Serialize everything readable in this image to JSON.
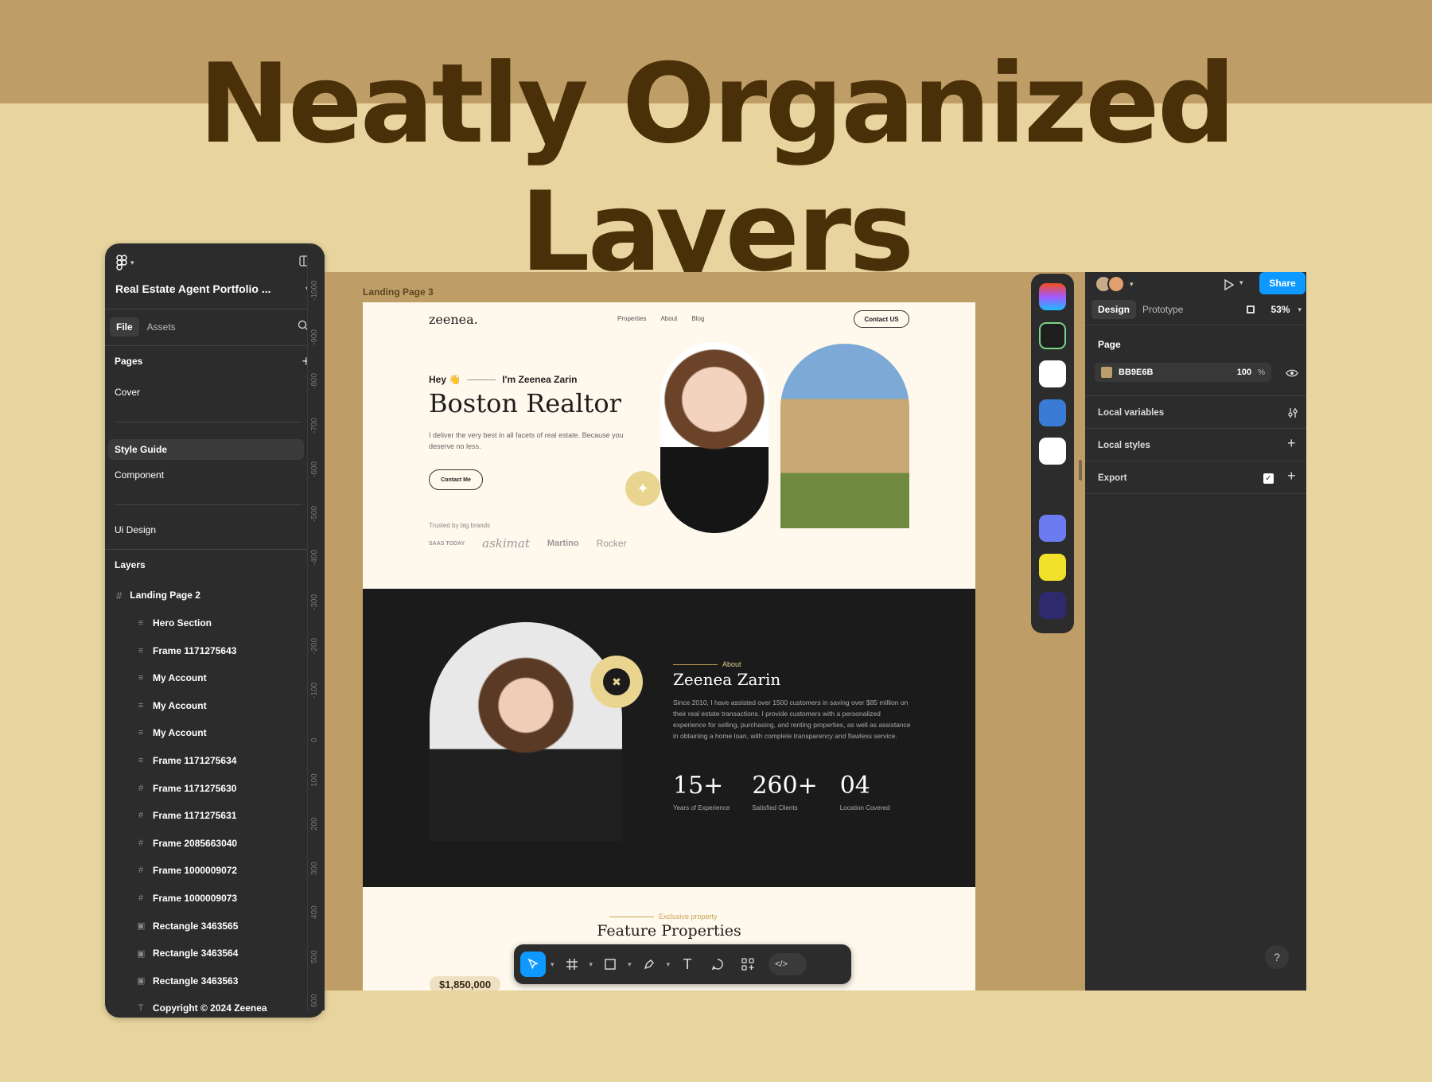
{
  "headline": "Neatly Organized Layers",
  "left_panel": {
    "project_title": "Real Estate Agent Portfolio ...",
    "tab_file": "File",
    "tab_assets": "Assets",
    "pages_header": "Pages",
    "pages": [
      "Cover",
      "Style Guide",
      "Component",
      "Ui Design"
    ],
    "selected_page": "Style Guide",
    "layers_header": "Layers",
    "layer_root": "Landing Page 2",
    "layers": [
      {
        "name": "Hero Section",
        "icon": "auto-layout-icon"
      },
      {
        "name": "Frame 1171275643",
        "icon": "auto-layout-icon"
      },
      {
        "name": "My Account",
        "icon": "auto-layout-icon"
      },
      {
        "name": "My Account",
        "icon": "auto-layout-icon"
      },
      {
        "name": "My Account",
        "icon": "auto-layout-icon"
      },
      {
        "name": "Frame 1171275634",
        "icon": "auto-layout-icon"
      },
      {
        "name": "Frame 1171275630",
        "icon": "frame-icon"
      },
      {
        "name": "Frame 1171275631",
        "icon": "frame-icon"
      },
      {
        "name": "Frame 2085663040",
        "icon": "frame-icon"
      },
      {
        "name": "Frame 1000009072",
        "icon": "frame-icon"
      },
      {
        "name": "Frame 1000009073",
        "icon": "frame-icon"
      },
      {
        "name": "Rectangle 3463565",
        "icon": "image-icon"
      },
      {
        "name": "Rectangle 3463564",
        "icon": "image-icon"
      },
      {
        "name": "Rectangle 3463563",
        "icon": "image-icon"
      },
      {
        "name": "Copyright © 2024 Zeenea",
        "icon": "text-icon"
      }
    ],
    "ruler_ticks": [
      "-1000",
      "-900",
      "-800",
      "-700",
      "-600",
      "-500",
      "-400",
      "-300",
      "-200",
      "-100",
      "0",
      "100",
      "200",
      "300",
      "400",
      "500",
      "600"
    ]
  },
  "canvas": {
    "frame_label": "Landing Page 3",
    "background": "#BE9E66",
    "site": {
      "logo": "zeenea.",
      "nav": [
        "Properties",
        "About",
        "Blog"
      ],
      "contact_button": "Contact US",
      "greeting": "Hey 👋",
      "intro": "I'm Zeenea Zarin",
      "title": "Boston Realtor",
      "description": "I deliver the very best in all facets of real estate. Because you deserve no less.",
      "cta": "Contact Me",
      "trusted": "Trusted by big brands",
      "brands": [
        "SAAS TODAY",
        "askimat",
        "Martino",
        "Rocker"
      ],
      "about_kicker": "About",
      "about_name": "Zeenea Zarin",
      "about_text": "Since 2010, I have assisted over 1500 customers in saving over $85 million on their real estate transactions. I provide customers with a personalized experience for selling, purchasing, and renting properties, as well as assistance in obtaining a home loan, with complete transparency and flawless service.",
      "stats": [
        {
          "value": "15+",
          "label": "Years of Experience"
        },
        {
          "value": "260+",
          "label": "Satisfied Clients"
        },
        {
          "value": "04",
          "label": "Location Covered"
        }
      ],
      "exclusive_kicker": "Exclusive property",
      "feature_title": "Feature Properties",
      "price": "$1,850,000"
    }
  },
  "toolbar": {
    "tools": [
      "move-icon",
      "frame-icon",
      "rectangle-icon",
      "pen-icon",
      "text-icon",
      "comment-icon",
      "actions-icon",
      "dev-mode-icon"
    ]
  },
  "plugins": [
    "figma-plugin",
    "color-wheel-plugin",
    "home-plugin",
    "lorem-ipsum-plugin",
    "unsplash-plugin",
    "color-chart-plugin",
    "layers-plugin",
    "builder-plugin",
    "style-plugin"
  ],
  "right_panel": {
    "share_button": "Share",
    "tab_design": "Design",
    "tab_prototype": "Prototype",
    "zoom": "53%",
    "page_header": "Page",
    "page_color": "BB9E6B",
    "page_swatch": "#BB9E6B",
    "page_opacity": "100",
    "opacity_unit": "%",
    "local_variables": "Local variables",
    "local_styles": "Local styles",
    "export": "Export",
    "help": "?"
  },
  "colors": {
    "accent": "#0D99FF",
    "dark": "#2C2C2C",
    "gold": "#C9A455"
  }
}
